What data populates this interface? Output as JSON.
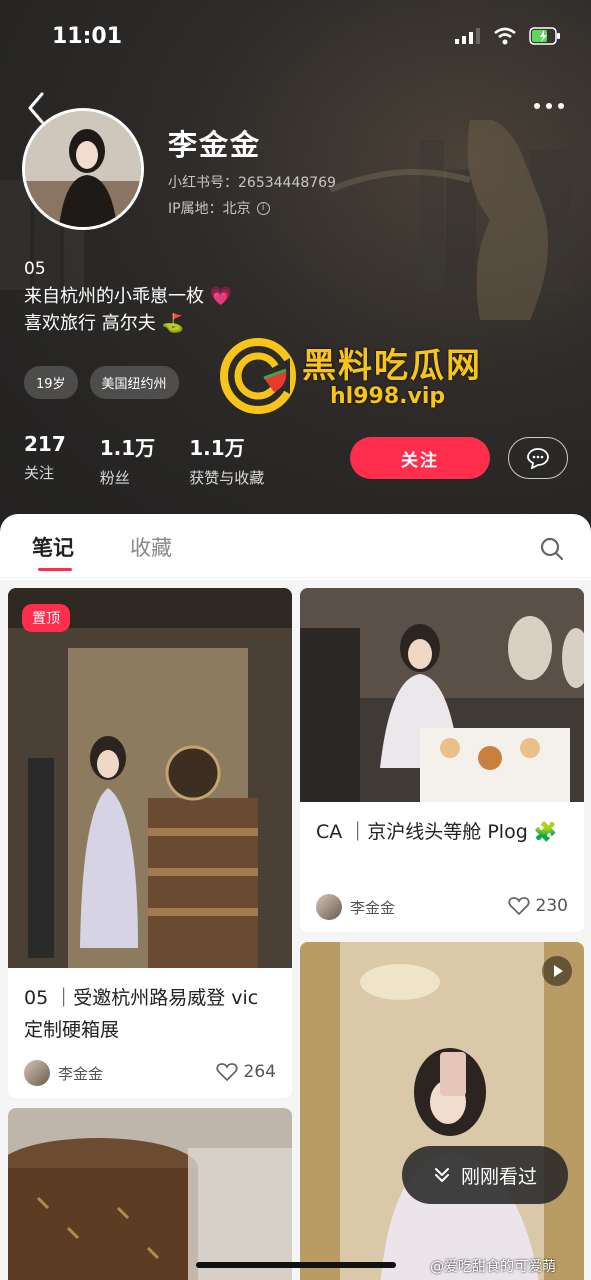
{
  "status_bar": {
    "time": "11:01"
  },
  "profile": {
    "nickname": "李金金",
    "redbook_id": "小红书号：26534448769",
    "ip_location": "IP属地：北京",
    "bio_line1": "05",
    "bio_line2": "来自杭州的小乖崽一枚 💗",
    "bio_line3": "喜欢旅行 高尔夫 ⛳",
    "tags": [
      "19岁",
      "美国纽约州"
    ],
    "stats": [
      {
        "value": "217",
        "label": "关注"
      },
      {
        "value": "1.1万",
        "label": "粉丝"
      },
      {
        "value": "1.1万",
        "label": "获赞与收藏"
      }
    ],
    "follow_label": "关注"
  },
  "watermark": {
    "title": "黑料吃瓜网",
    "site": "hl998.vip",
    "weibo": "@爱吃甜食的可爱萌"
  },
  "tabs": {
    "notes": "笔记",
    "collect": "收藏"
  },
  "notes": [
    {
      "badge": "置顶",
      "title": "05 ｜受邀杭州路易威登 vic定制硬箱展",
      "author": "李金金",
      "likes": "264"
    },
    {
      "title": "CA ｜京沪线头等舱 Plog 🧩",
      "author": "李金金",
      "likes": "230"
    }
  ],
  "recent_button": "刚刚看过",
  "colors": {
    "accent": "#ff2e4d",
    "header_bg": "#2a2827",
    "watermark": "#f7c41a"
  },
  "icons": [
    "back-icon",
    "more-icon",
    "message-icon",
    "search-icon",
    "heart-icon",
    "play-icon",
    "chevron-down-double-icon"
  ]
}
